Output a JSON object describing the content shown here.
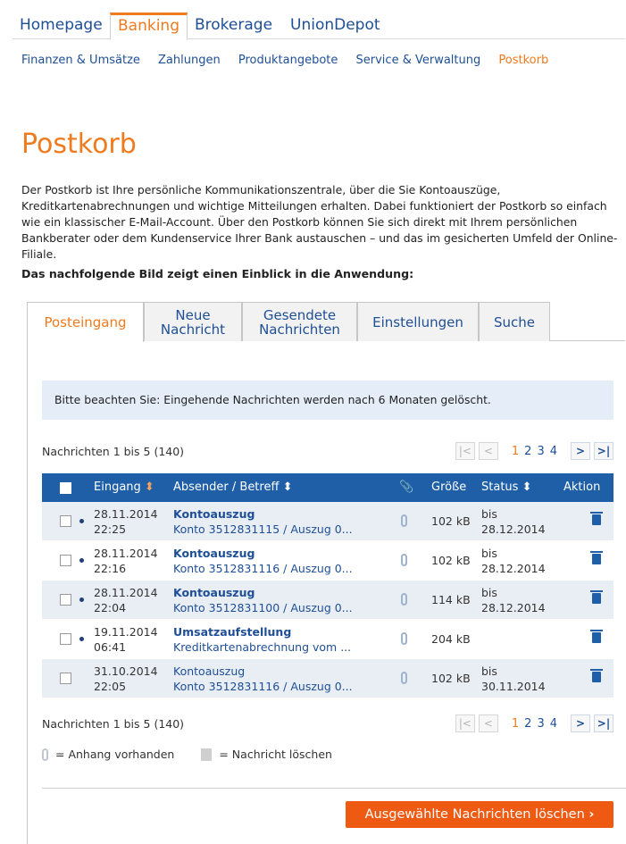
{
  "topnav": {
    "items": [
      "Homepage",
      "Banking",
      "Brokerage",
      "UnionDepot"
    ],
    "active": "Banking"
  },
  "subnav": {
    "items": [
      "Finanzen & Umsätze",
      "Zahlungen",
      "Produktangebote",
      "Service & Verwaltung",
      "Postkorb"
    ],
    "active": "Postkorb"
  },
  "page": {
    "title": "Postkorb",
    "intro": "Der Postkorb ist Ihre persönliche Kommunikationszentrale, über die Sie Kontoauszüge, Kreditkartenabrechnungen und wichtige Mitteilungen erhalten. Dabei funktioniert der Postkorb so einfach wie ein klassischer E-Mail-Account. Über den Postkorb können Sie sich direkt mit Ihrem persönlichen Bankberater oder dem Kundenservice Ihrer Bank austauschen – und das im gesicherten Umfeld der Online-Filiale.",
    "lead": "Das nachfolgende Bild zeigt einen Einblick in die Anwendung:"
  },
  "tabs": [
    {
      "line1": "Posteingang",
      "line2": ""
    },
    {
      "line1": "Neue",
      "line2": "Nachricht"
    },
    {
      "line1": "Gesendete",
      "line2": "Nachrichten"
    },
    {
      "line1": "Einstellungen",
      "line2": ""
    },
    {
      "line1": "Suche",
      "line2": ""
    }
  ],
  "notice": "Bitte beachten Sie: Eingehende Nachrichten werden nach 6 Monaten gelöscht.",
  "pager": {
    "count_text": "Nachrichten 1 bis 5 (140)",
    "pages": [
      "1",
      "2",
      "3",
      "4"
    ],
    "current": "1",
    "first": "|<",
    "prev": "<",
    "next": ">",
    "last": ">|"
  },
  "table": {
    "headers": {
      "eingang": "Eingang",
      "absender": "Absender / Betreff",
      "groesse": "Größe",
      "status": "Status",
      "aktion": "Aktion"
    },
    "rows": [
      {
        "date": "28.11.2014",
        "time": "22:25",
        "subject": "Kontoauszug",
        "detail": "Konto 3512831115 / Auszug 0...",
        "size": "102 kB",
        "status1": "bis",
        "status2": "28.12.2014",
        "unread": true
      },
      {
        "date": "28.11.2014",
        "time": "22:16",
        "subject": "Kontoauszug",
        "detail": "Konto 3512831116 / Auszug 0...",
        "size": "102 kB",
        "status1": "bis",
        "status2": "28.12.2014",
        "unread": true
      },
      {
        "date": "28.11.2014",
        "time": "22:04",
        "subject": "Kontoauszug",
        "detail": "Konto 3512831100 / Auszug 0...",
        "size": "114 kB",
        "status1": "bis",
        "status2": "28.12.2014",
        "unread": true
      },
      {
        "date": "19.11.2014",
        "time": "06:41",
        "subject": "Umsatzaufstellung",
        "detail": "Kreditkartenabrechnung vom ...",
        "size": "204 kB",
        "status1": "",
        "status2": "",
        "unread": true
      },
      {
        "date": "31.10.2014",
        "time": "22:05",
        "subject": "Kontoauszug",
        "detail": "Konto 3512831116 / Auszug 0...",
        "size": "102 kB",
        "status1": "bis",
        "status2": "30.11.2014",
        "unread": false
      }
    ]
  },
  "legend": {
    "attachment": "= Anhang vorhanden",
    "delete": "= Nachricht löschen"
  },
  "delete_button": "Ausgewählte Nachrichten löschen",
  "icons": {
    "sort": "sort-icon",
    "attachment": "paperclip-icon",
    "delete": "trash-icon",
    "chevron": "chevron-right-icon"
  },
  "colors": {
    "accent": "#f07a1e",
    "link": "#1e4f96",
    "header": "#1e5fa8",
    "row_alt": "#e9eef5",
    "button": "#ee5a12"
  }
}
